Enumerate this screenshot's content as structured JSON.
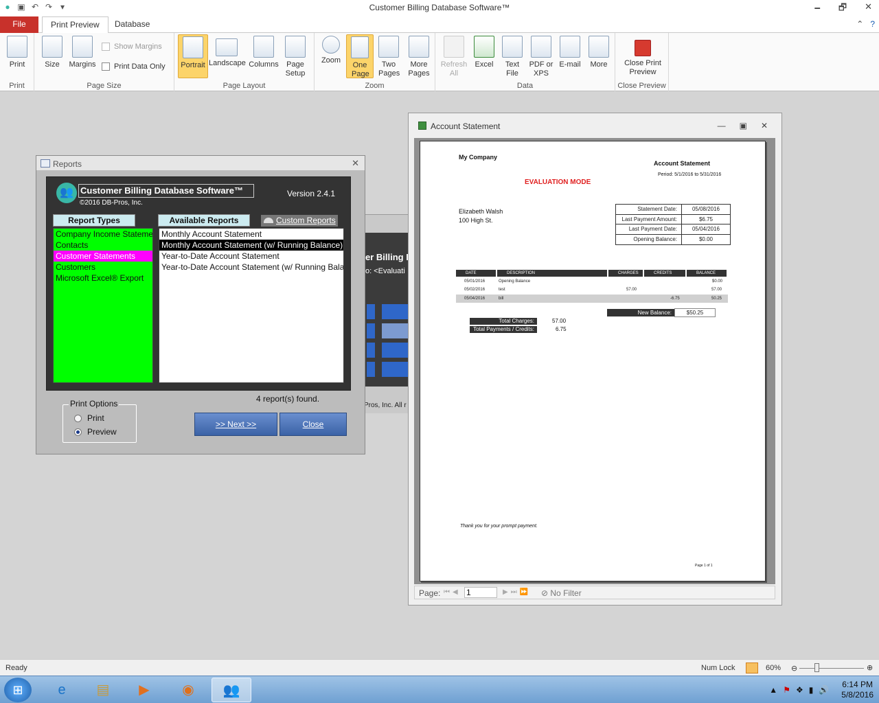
{
  "window": {
    "title": "Customer Billing Database Software™",
    "controls": [
      "🗕",
      "🗗",
      "✕"
    ]
  },
  "ribbon": {
    "file_tab": "File",
    "tabs": [
      "Print Preview",
      "Database"
    ],
    "groups": {
      "print": {
        "label": "Print",
        "buttons": [
          "Print"
        ]
      },
      "page_size": {
        "label": "Page Size",
        "buttons": [
          "Size",
          "Margins"
        ],
        "checkboxes": [
          "Show Margins",
          "Print Data Only"
        ]
      },
      "page_layout": {
        "label": "Page Layout",
        "buttons": [
          "Portrait",
          "Landscape",
          "Columns",
          "Page Setup"
        ]
      },
      "zoom": {
        "label": "Zoom",
        "buttons": [
          "Zoom",
          "One Page",
          "Two Pages",
          "More Pages"
        ]
      },
      "data": {
        "label": "Data",
        "buttons": [
          "Refresh All",
          "Excel",
          "Text File",
          "PDF or XPS",
          "E-mail",
          "More"
        ]
      },
      "close_preview": {
        "label": "Close Preview",
        "buttons": [
          "Close Print Preview"
        ]
      }
    }
  },
  "reports_dialog": {
    "title": "Reports",
    "app_name": "Customer Billing Database Software™",
    "copyright": "©2016 DB-Pros, Inc.",
    "version": "Version 2.4.1",
    "report_types_header": "Report Types",
    "available_reports_header": "Available Reports",
    "custom_reports": "Custom Reports",
    "report_types": [
      "Company Income Statement",
      "Contacts",
      "Customer Statements",
      "Customers",
      "Microsoft Excel® Export"
    ],
    "selected_type_index": 2,
    "available_reports": [
      "Monthly Account Statement",
      "Monthly Account Statement (w/ Running Balance)",
      "Year-to-Date Account Statement",
      "Year-to-Date Account Statement (w/ Running Balance)"
    ],
    "selected_report_index": 1,
    "count_text": "4 report(s) found.",
    "print_options_label": "Print Options",
    "print_options": [
      "Print",
      "Preview"
    ],
    "selected_print_option": "Preview",
    "next_button": ">> Next >>",
    "close_button": "Close"
  },
  "background_window": {
    "title_fragment": "er Billing D",
    "to_fragment": "o:  <Evaluati",
    "footer_fragment": "Pros, Inc.  All r"
  },
  "statement_window": {
    "title": "Account Statement",
    "company": "My Company",
    "doc_title": "Account Statement",
    "period": "Period: 5/1/2016 to 5/31/2016",
    "evaluation": "EVALUATION MODE",
    "customer_name": "Elizabeth Walsh",
    "customer_address": "100 High St.",
    "info": [
      {
        "label": "Statement Date:",
        "value": "05/08/2016"
      },
      {
        "label": "Last Payment Amount:",
        "value": "$6.75"
      },
      {
        "label": "Last Payment Date:",
        "value": "05/04/2016"
      },
      {
        "label": "Opening Balance:",
        "value": "$0.00"
      }
    ],
    "columns": [
      "DATE",
      "DESCRIPTION",
      "CHARGES",
      "CREDITS",
      "BALANCE"
    ],
    "rows": [
      {
        "date": "05/01/2016",
        "description": "Opening Balance",
        "charges": "",
        "credits": "",
        "balance": "$0.00"
      },
      {
        "date": "05/02/2016",
        "description": "test",
        "charges": "57.00",
        "credits": "",
        "balance": "57.00"
      },
      {
        "date": "05/04/2016",
        "description": "bill",
        "charges": "",
        "credits": "-6.75",
        "balance": "50.25"
      }
    ],
    "new_balance_label": "New Balance:",
    "new_balance": "$50.25",
    "total_charges_label": "Total Charges:",
    "total_charges": "57.00",
    "total_payments_label": "Total Payments / Credits:",
    "total_payments": "6.75",
    "thanks": "Thank you for your prompt payment.",
    "page_of": "Page 1 of 1",
    "nav_page_label": "Page:",
    "nav_page_value": "1",
    "nav_filter": "No Filter"
  },
  "status_bar": {
    "ready": "Ready",
    "num_lock": "Num Lock",
    "zoom": "60%",
    "zoom_level": 0.6
  },
  "taskbar": {
    "time": "6:14 PM",
    "date": "5/8/2016"
  },
  "colors": {
    "file_tab": "#c8312b",
    "report_types_bg": "#00ff00",
    "selected_type": "#ff00ff",
    "evaluation_text": "#e02020",
    "active_ribbon": "#fcd46a"
  }
}
